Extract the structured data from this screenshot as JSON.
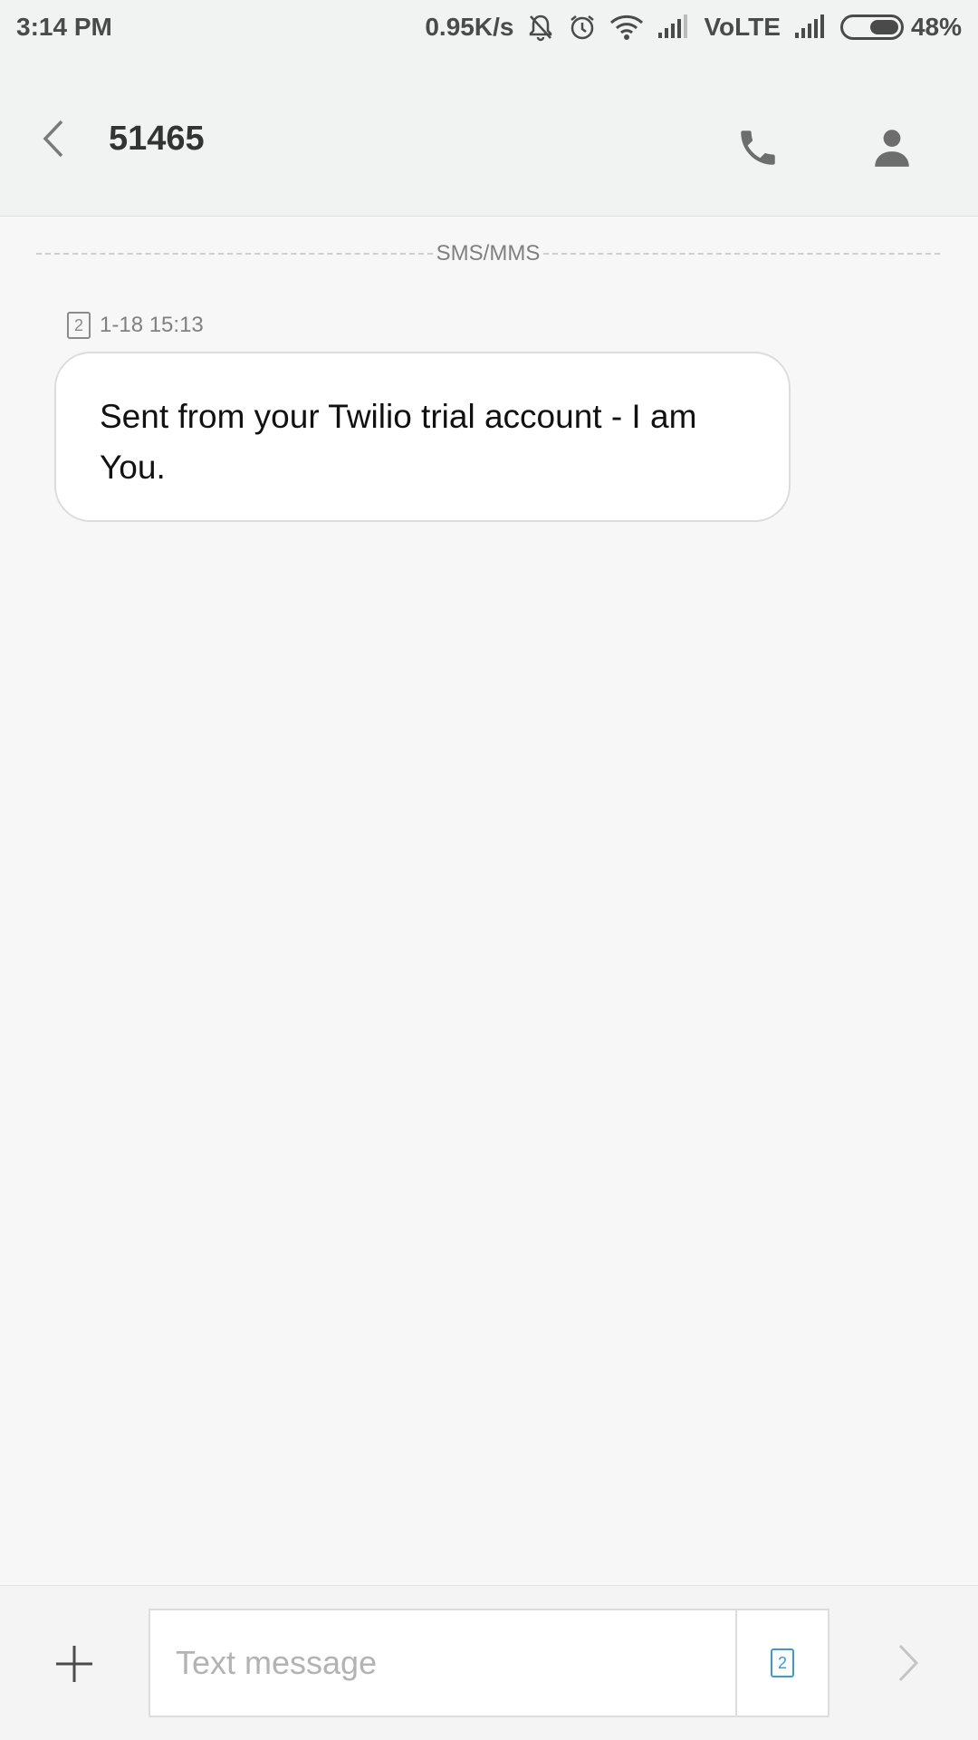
{
  "status_bar": {
    "time": "3:14 PM",
    "net_speed": "0.95K/s",
    "volte_label": "VoLTE",
    "battery_percent": "48%",
    "battery_level": 0.48
  },
  "header": {
    "title": "51465",
    "icons": {
      "back": "back-arrow-icon",
      "call": "phone-icon",
      "profile": "person-icon"
    }
  },
  "thread": {
    "divider_label": "SMS/MMS",
    "messages": [
      {
        "sim": "2",
        "timestamp": "1-18 15:13",
        "text": "Sent from your Twilio trial account - I am You."
      }
    ]
  },
  "composer": {
    "placeholder": "Text message",
    "value": "",
    "sim_label": "2",
    "accent_color": "#3a9ad9"
  }
}
